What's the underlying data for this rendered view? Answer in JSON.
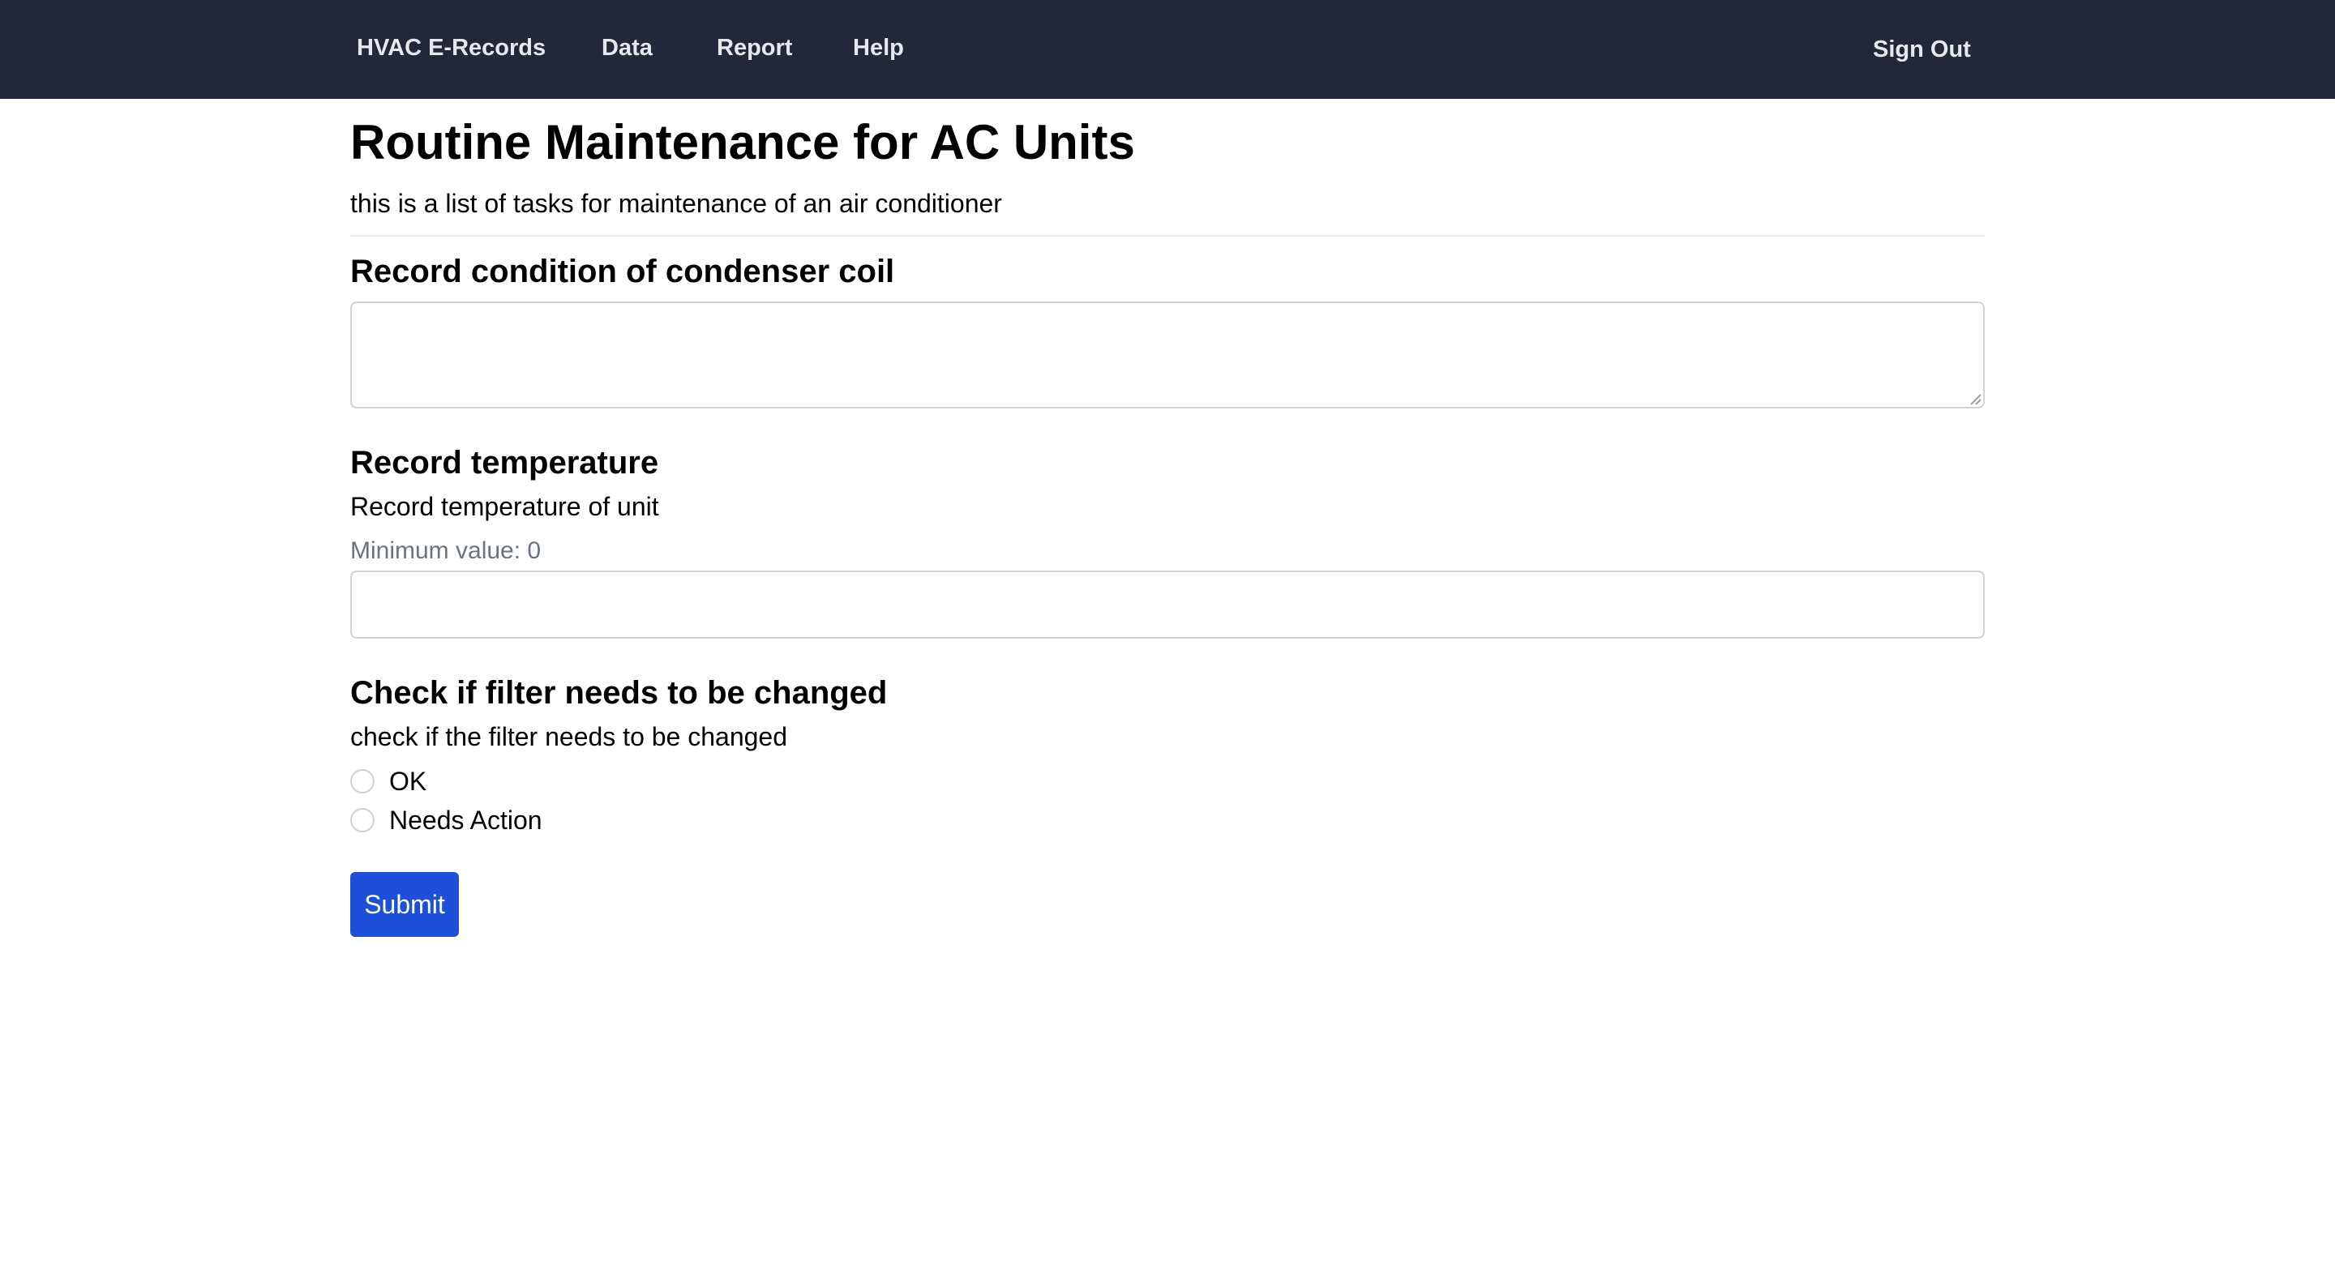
{
  "nav": {
    "brand": "HVAC E-Records",
    "items": [
      "Data",
      "Report",
      "Help"
    ],
    "sign_out": "Sign Out"
  },
  "page": {
    "title": "Routine Maintenance for AC Units",
    "description": "this is a list of tasks for maintenance of an air conditioner"
  },
  "tasks": {
    "condenser": {
      "title": "Record condition of condenser coil",
      "value": ""
    },
    "temperature": {
      "title": "Record temperature",
      "description": "Record temperature of unit",
      "min_label": "Minimum value: 0",
      "value": ""
    },
    "filter": {
      "title": "Check if filter needs to be changed",
      "description": "check if the filter needs to be changed",
      "options": [
        "OK",
        "Needs Action"
      ],
      "selected": null
    }
  },
  "form": {
    "submit_label": "Submit"
  },
  "colors": {
    "navbar_bg": "#222837",
    "nav_text": "#e6e8ec",
    "primary_button": "#1e4fd8",
    "muted_text": "#6b7280",
    "border": "#cfd3d8"
  }
}
